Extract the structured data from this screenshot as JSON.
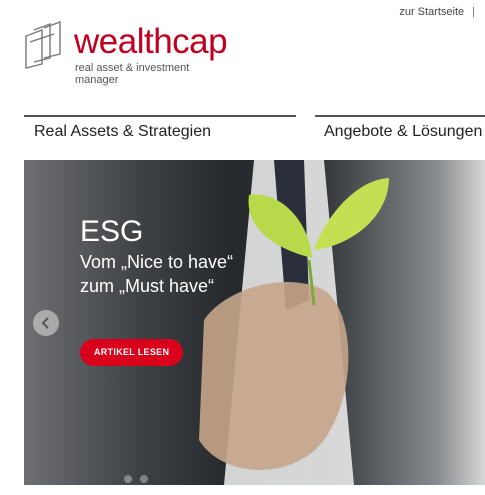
{
  "topbar": {
    "home_link": "zur Startseite",
    "separator": "|"
  },
  "logo": {
    "brand": "wealthcap",
    "tagline_line1": "real asset & investment",
    "tagline_line2": "manager",
    "brand_color": "#c0001e"
  },
  "nav": {
    "items": [
      {
        "label": "Real Assets & Strategien"
      },
      {
        "label": "Angebote & Lösungen"
      }
    ]
  },
  "hero": {
    "title": "ESG",
    "subtitle_line1": "Vom „Nice to have“",
    "subtitle_line2": "zum „Must have“",
    "cta_label": "ARTIKEL LESEN",
    "cta_color": "#d8001a",
    "prev_icon": "chevron-left-icon"
  }
}
